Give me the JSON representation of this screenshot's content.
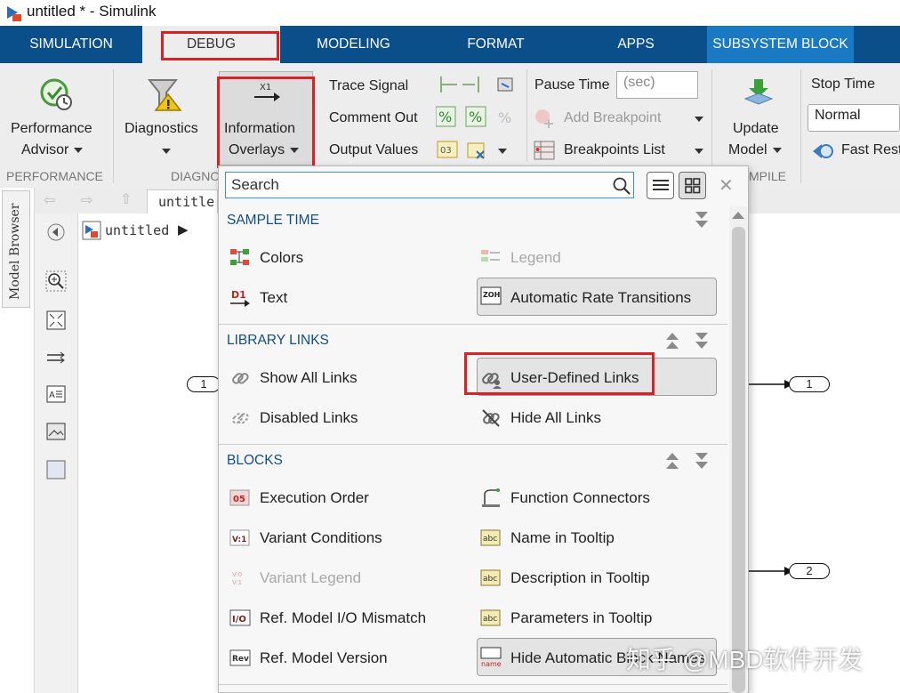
{
  "window": {
    "title": "untitled * - Simulink"
  },
  "tabs": [
    {
      "label": "SIMULATION"
    },
    {
      "label": "DEBUG"
    },
    {
      "label": "MODELING"
    },
    {
      "label": "FORMAT"
    },
    {
      "label": "APPS"
    },
    {
      "label": "SUBSYSTEM BLOCK"
    }
  ],
  "ribbon": {
    "performance": {
      "label_line1": "Performance",
      "label_line2": "Advisor",
      "section": "PERFORMANCE"
    },
    "diagnostics": {
      "label": "Diagnostics",
      "section": "DIAGNO"
    },
    "info_overlays": {
      "label_line1": "Information",
      "label_line2": "Overlays"
    },
    "trace_signal": "Trace Signal",
    "comment_out": "Comment Out",
    "output_values": "Output Values",
    "pause_time": {
      "label": "Pause Time",
      "placeholder": "(sec)"
    },
    "add_breakpoint": "Add Breakpoint",
    "breakpoints_list": "Breakpoints List",
    "update_model": {
      "line1": "Update",
      "line2": "Model",
      "section": "MPILE"
    },
    "stop_time": {
      "label": "Stop Time",
      "mode": "Normal",
      "fast_restart": "Fast Rest"
    }
  },
  "left": {
    "model_browser": "Model Browser",
    "breadcrumb_tab": "untitle",
    "crumb": "untitled"
  },
  "canvas": {
    "in1": "1",
    "out1": "1",
    "out2": "2"
  },
  "panel": {
    "search_placeholder": "Search",
    "sections": [
      {
        "title": "SAMPLE TIME",
        "items": [
          {
            "label": "Colors"
          },
          {
            "label": "Legend"
          },
          {
            "label": "Text"
          },
          {
            "label": "Automatic Rate Transitions"
          }
        ]
      },
      {
        "title": "LIBRARY LINKS",
        "items": [
          {
            "label": "Show All Links"
          },
          {
            "label": "User-Defined Links"
          },
          {
            "label": "Disabled Links"
          },
          {
            "label": "Hide All Links"
          }
        ]
      },
      {
        "title": "BLOCKS",
        "items": [
          {
            "label": "Execution Order"
          },
          {
            "label": "Function Connectors"
          },
          {
            "label": "Variant Conditions"
          },
          {
            "label": "Name in Tooltip"
          },
          {
            "label": "Variant Legend"
          },
          {
            "label": "Description in Tooltip"
          },
          {
            "label": "Ref. Model I/O Mismatch"
          },
          {
            "label": "Parameters in Tooltip"
          },
          {
            "label": "Ref. Model Version"
          },
          {
            "label": "Hide Automatic Block Names"
          }
        ]
      }
    ]
  },
  "watermark": "知乎 @MBD软件开发",
  "colors": {
    "accent_blue": "#0b4f8a",
    "context_tab": "#1979c3",
    "highlight_red": "#d92128",
    "section_blue": "#124f86"
  }
}
